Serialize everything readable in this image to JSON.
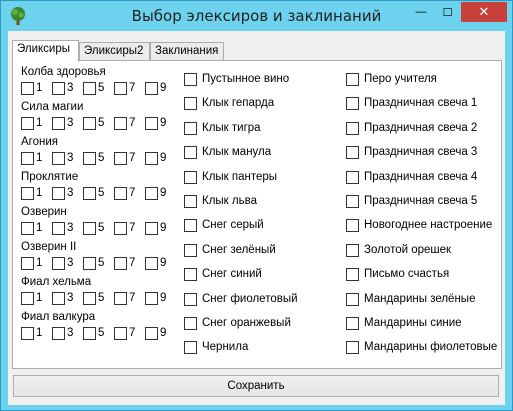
{
  "window": {
    "title": "Выбор элексиров и заклинаний",
    "minimize_glyph": "—",
    "maximize_glyph": "☐",
    "close_glyph": "✕",
    "icon": "tree-icon"
  },
  "tabs": [
    {
      "label": "Эликсиры",
      "active": true
    },
    {
      "label": "Эликсиры2",
      "active": false
    },
    {
      "label": "Заклинания",
      "active": false
    }
  ],
  "elixirs": [
    {
      "label": "Колба здоровья",
      "options": [
        "1",
        "3",
        "5",
        "7",
        "9"
      ]
    },
    {
      "label": "Сила магии",
      "options": [
        "1",
        "3",
        "5",
        "7",
        "9"
      ]
    },
    {
      "label": "Агония",
      "options": [
        "1",
        "3",
        "5",
        "7",
        "9"
      ]
    },
    {
      "label": "Проклятие",
      "options": [
        "1",
        "3",
        "5",
        "7",
        "9"
      ]
    },
    {
      "label": "Озверин",
      "options": [
        "1",
        "3",
        "5",
        "7",
        "9"
      ]
    },
    {
      "label": "Озверин II",
      "options": [
        "1",
        "3",
        "5",
        "7",
        "9"
      ]
    },
    {
      "label": "Фиал хельма",
      "options": [
        "1",
        "3",
        "5",
        "7",
        "9"
      ]
    },
    {
      "label": "Фиал валкура",
      "options": [
        "1",
        "3",
        "5",
        "7",
        "9"
      ]
    }
  ],
  "middle_column": [
    "Пустынное вино",
    "Клык гепарда",
    "Клык тигра",
    "Клык манула",
    "Клык пантеры",
    "Клык льва",
    "Снег серый",
    "Снег зелёный",
    "Снег синий",
    "Снег фиолетовый",
    "Снег оранжевый",
    "Чернила"
  ],
  "right_column": [
    "Перо учителя",
    "Праздничная свеча 1",
    "Праздничная свеча 2",
    "Праздничная свеча 3",
    "Праздничная свеча 4",
    "Праздничная свеча 5",
    "Новогоднее настроение",
    "Золотой орешек",
    "Письмо счастья",
    "Мандарины зелёные",
    "Мандарины синие",
    "Мандарины фиолетовые"
  ],
  "save_label": "Сохранить",
  "colors": {
    "frame": "#6cd2ee",
    "close_button": "#c7413a"
  }
}
